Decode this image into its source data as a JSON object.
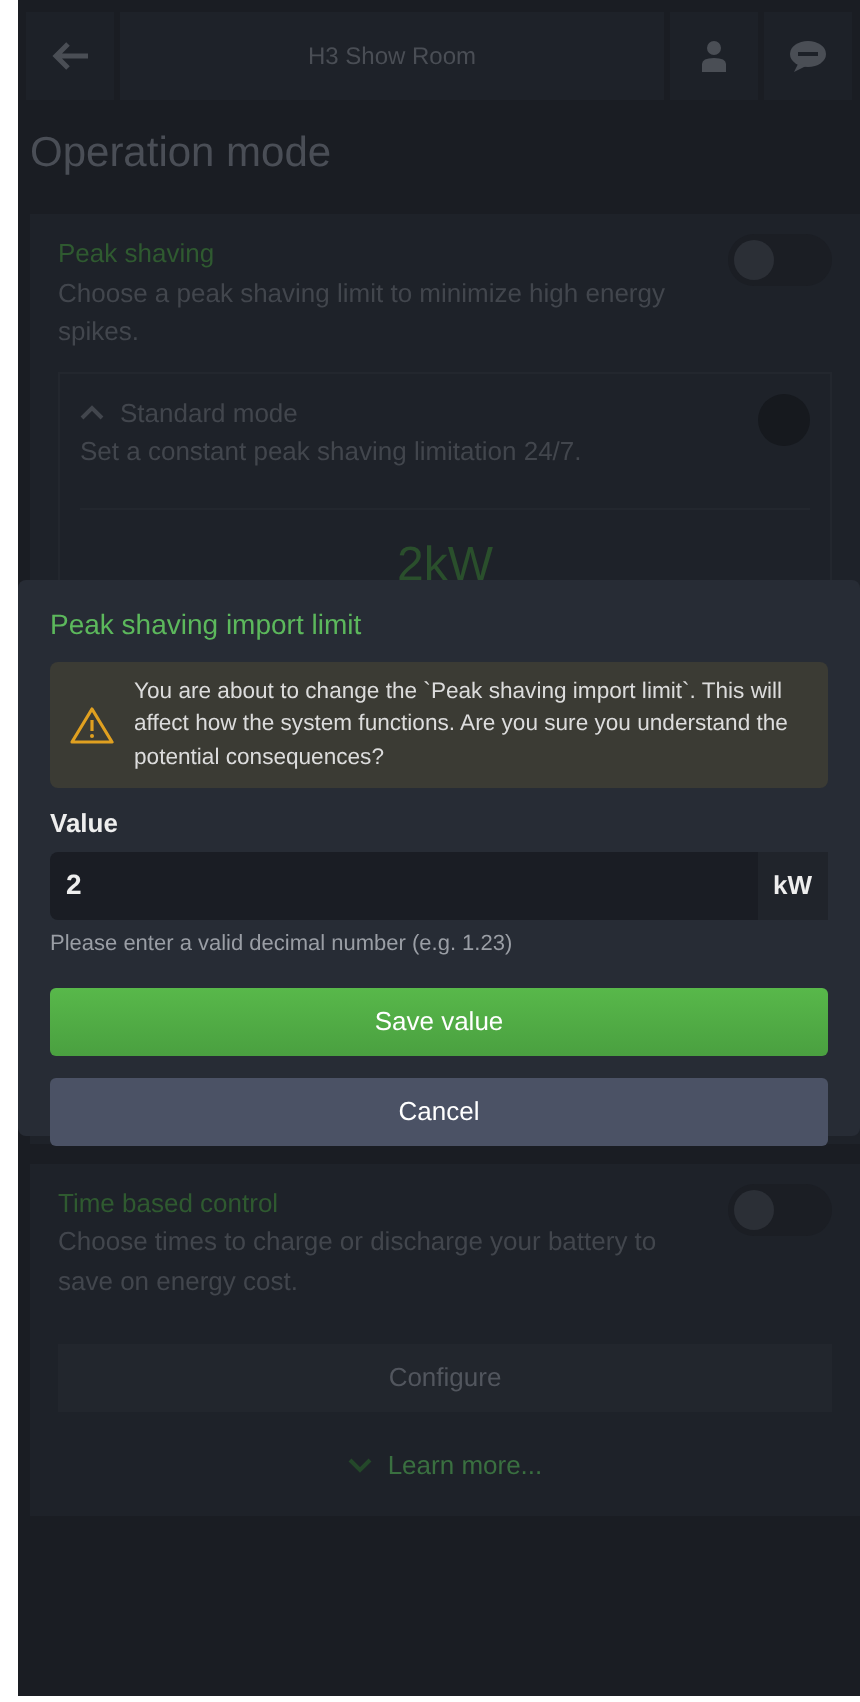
{
  "header": {
    "title": "H3 Show Room"
  },
  "page_title": "Operation mode",
  "modes": [
    {
      "kind": "peak",
      "title": "Peak shaving",
      "description": "Choose a peak shaving limit to minimize high energy spikes.",
      "on": false,
      "submodes": [
        {
          "title": "Standard mode",
          "description": "Set a constant peak shaving limitation 24/7.",
          "expanded": true,
          "selected": false,
          "value": "2kW"
        }
      ]
    },
    {
      "kind": "time",
      "title": "Time based control",
      "description": "Choose times to charge or discharge your battery to save on energy cost.",
      "on": false,
      "button": "Configure",
      "link": "Learn more..."
    }
  ],
  "dialog": {
    "title": "Peak shaving import limit",
    "warning": "You are about to change the `Peak shaving import limit`. This will affect how the system functions. Are you sure you understand the potential consequences?",
    "value_label": "Value",
    "value": "2",
    "unit": "kW",
    "hint": "Please enter a valid decimal number (e.g. 1.23)",
    "buttons": [
      {
        "kind": "primary",
        "label": "Save value"
      },
      {
        "kind": "secondary",
        "label": "Cancel"
      }
    ]
  }
}
